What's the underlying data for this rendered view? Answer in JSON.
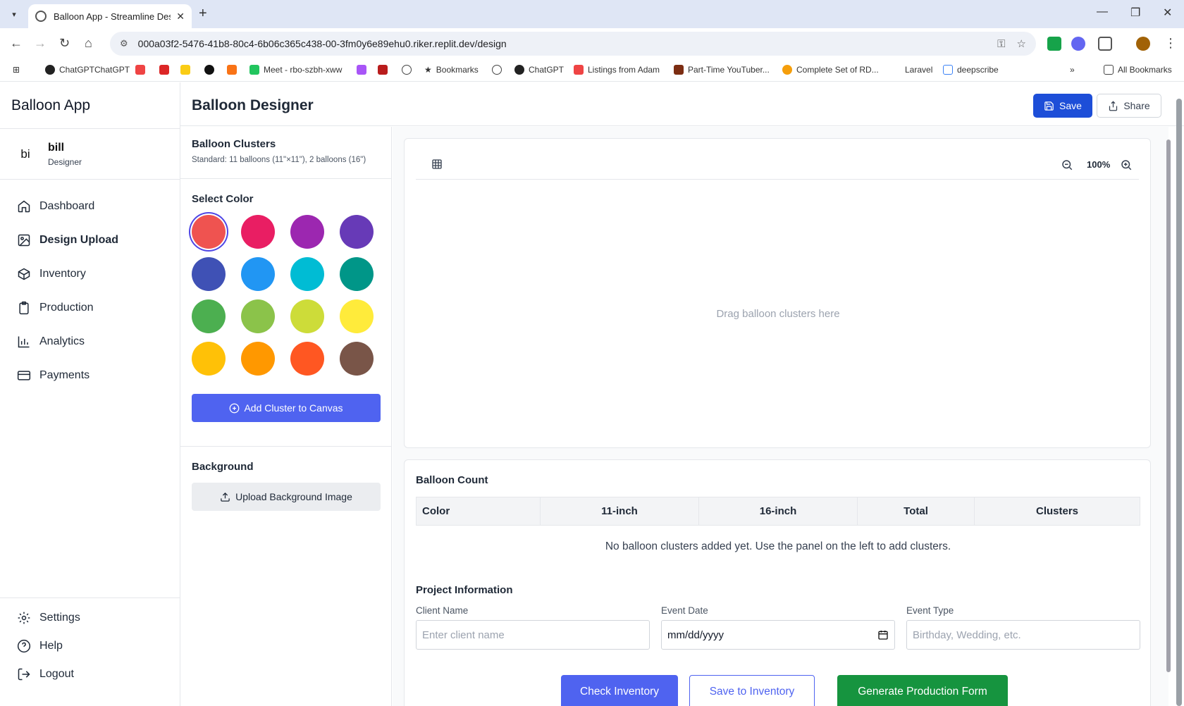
{
  "browser": {
    "tab_title": "Balloon App - Streamline Desig",
    "url": "000a03f2-5476-41b8-80c4-6b06c365c438-00-3fm0y6e89ehu0.riker.replit.dev/design",
    "bookmarks": [
      "ChatGPTChatGPT",
      "Meet - rbo-szbh-xww",
      "Bookmarks",
      "ChatGPT",
      "Listings from Adam",
      "Part-Time YouTuber...",
      "Complete Set of RD...",
      "Laravel",
      "deepscribe"
    ],
    "all_bookmarks": "All Bookmarks"
  },
  "app": {
    "brand": "Balloon App",
    "user": {
      "initials": "bi",
      "name": "bill",
      "role": "Designer"
    },
    "nav": [
      {
        "label": "Dashboard",
        "icon": "home-icon"
      },
      {
        "label": "Design Upload",
        "icon": "image-icon"
      },
      {
        "label": "Inventory",
        "icon": "box-icon"
      },
      {
        "label": "Production",
        "icon": "clipboard-icon"
      },
      {
        "label": "Analytics",
        "icon": "bar-chart-icon"
      },
      {
        "label": "Payments",
        "icon": "credit-card-icon"
      }
    ],
    "bottom_nav": [
      {
        "label": "Settings",
        "icon": "gear-icon"
      },
      {
        "label": "Help",
        "icon": "help-icon"
      },
      {
        "label": "Logout",
        "icon": "logout-icon"
      }
    ]
  },
  "header": {
    "title": "Balloon Designer",
    "save_label": "Save",
    "share_label": "Share"
  },
  "panel": {
    "clusters_title": "Balloon Clusters",
    "clusters_sub": "Standard: 11 balloons (11\"×11\"), 2 balloons (16\")",
    "color_title": "Select Color",
    "colors": [
      "#ef5350",
      "#e91e63",
      "#9c27b0",
      "#673ab7",
      "#3f51b5",
      "#2196f3",
      "#00bcd4",
      "#009688",
      "#4caf50",
      "#8bc34a",
      "#cddc39",
      "#ffeb3b",
      "#ffc107",
      "#ff9800",
      "#ff5722",
      "#795548"
    ],
    "selected_color": "#ef5350",
    "add_label": "Add Cluster to Canvas",
    "background_title": "Background",
    "upload_label": "Upload Background Image"
  },
  "canvas": {
    "zoom": "100%",
    "hint": "Drag balloon clusters here"
  },
  "count": {
    "title": "Balloon Count",
    "headers": [
      "Color",
      "11-inch",
      "16-inch",
      "Total",
      "Clusters"
    ],
    "empty": "No balloon clusters added yet. Use the panel on the left to add clusters."
  },
  "project": {
    "title": "Project Information",
    "client_label": "Client Name",
    "client_placeholder": "Enter client name",
    "date_label": "Event Date",
    "date_value": "mm/dd/yyyy",
    "type_label": "Event Type",
    "type_placeholder": "Birthday, Wedding, etc."
  },
  "actions": {
    "check": "Check Inventory",
    "save": "Save to Inventory",
    "generate": "Generate Production Form"
  }
}
